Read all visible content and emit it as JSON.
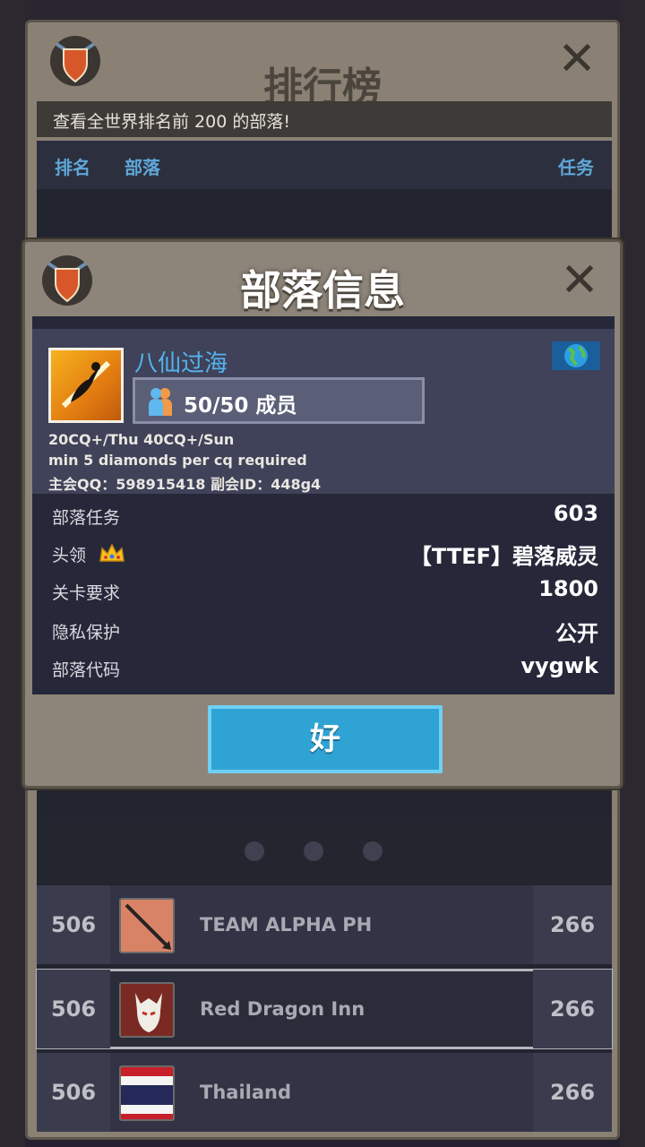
{
  "leaderboard": {
    "title": "排行榜",
    "subtitle": "查看全世界排名前 200 的部落!",
    "columns": {
      "rank": "排名",
      "tribe": "部落",
      "missions": "任务"
    },
    "rows": [
      {
        "rank": "506",
        "name": "TEAM ALPHA PH",
        "score": "266"
      },
      {
        "rank": "506",
        "name": "Red Dragon Inn",
        "score": "266",
        "selected": true
      },
      {
        "rank": "506",
        "name": "Thailand",
        "score": "266"
      }
    ]
  },
  "tribe_info": {
    "title": "部落信息",
    "name": "八仙过海",
    "members": "50/50 成员",
    "description": [
      "20CQ+/Thu  40CQ+/Sun",
      "min 5 diamonds per cq required",
      "主会QQ：598915418      副会ID：448g4"
    ],
    "stats": [
      {
        "label": "部落任务",
        "value": "603"
      },
      {
        "label": "头领",
        "value": "【TTEF】碧落威灵"
      },
      {
        "label": "关卡要求",
        "value": "1800"
      },
      {
        "label": "隐私保护",
        "value": "公开"
      },
      {
        "label": "部落代码",
        "value": "vygwk"
      }
    ],
    "ok_label": "好"
  },
  "colors": {
    "panel": "#8d8579",
    "card": "#26283a",
    "accent_blue": "#2fa3d4",
    "name_blue": "#55b3ee",
    "header_blue": "#5fa7d8"
  },
  "icons": {
    "shield": "tribe-shield-icon",
    "close": "close-icon",
    "members": "members-icon",
    "crown": "crown-icon",
    "flag": "globe-flag-icon"
  }
}
